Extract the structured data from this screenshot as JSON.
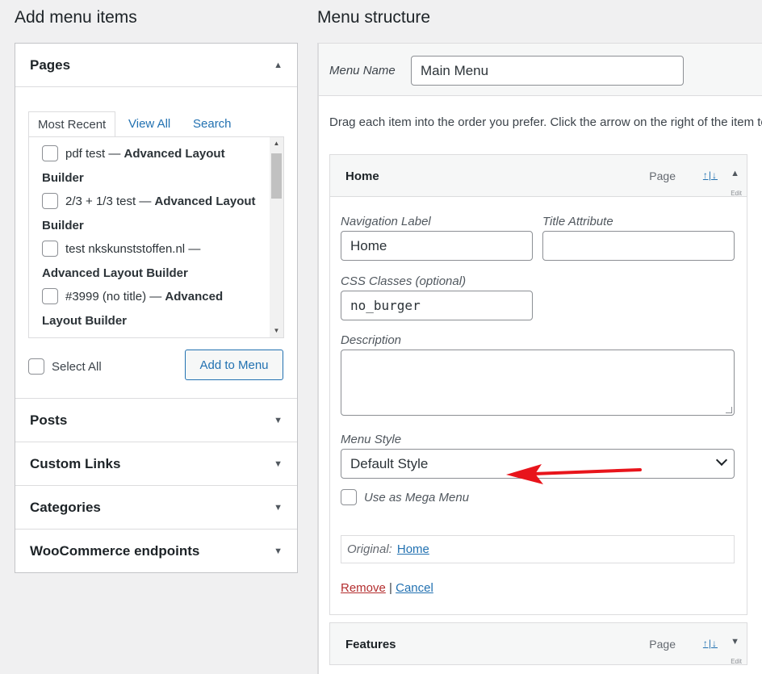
{
  "left": {
    "heading": "Add menu items",
    "pages": {
      "title": "Pages",
      "tabs": [
        "Most Recent",
        "View All",
        "Search"
      ],
      "items": [
        {
          "title": "pdf test",
          "builder": "Advanced Layout Builder"
        },
        {
          "title": "2/3 + 1/3 test",
          "builder": "Advanced Layout Builder"
        },
        {
          "title": "test nkskunststoffen.nl",
          "builder": "Advanced Layout Builder"
        },
        {
          "title": "#3999 (no title)",
          "builder": "Advanced Layout Builder"
        }
      ],
      "separator": "—",
      "select_all": "Select All",
      "add_button": "Add to Menu"
    },
    "sections": [
      "Posts",
      "Custom Links",
      "Categories",
      "WooCommerce endpoints"
    ]
  },
  "right": {
    "heading": "Menu structure",
    "menu_name_label": "Menu Name",
    "menu_name_value": "Main Menu",
    "instructions": "Drag each item into the order you prefer. Click the arrow on the right of the item to reveal additional configuration options.",
    "items": [
      {
        "title": "Home",
        "type": "Page",
        "updown": "↑|↓",
        "edit": "Edit",
        "navigation_label_title": "Navigation Label",
        "navigation_label_value": "Home",
        "title_attribute_title": "Title Attribute",
        "title_attribute_value": "",
        "css_classes_title": "CSS Classes (optional)",
        "css_classes_value": "no_burger",
        "description_title": "Description",
        "menu_style_title": "Menu Style",
        "menu_style_value": "Default Style",
        "mega_menu_label": "Use as Mega Menu",
        "original_label": "Original:",
        "original_link": "Home",
        "remove": "Remove",
        "divider": "|",
        "cancel": "Cancel"
      },
      {
        "title": "Features",
        "type": "Page",
        "updown": "↑|↓",
        "edit": "Edit"
      }
    ]
  },
  "colors": {
    "accent": "#2271b1",
    "remove": "#b32d2e",
    "annotation_arrow": "#e8141b"
  }
}
